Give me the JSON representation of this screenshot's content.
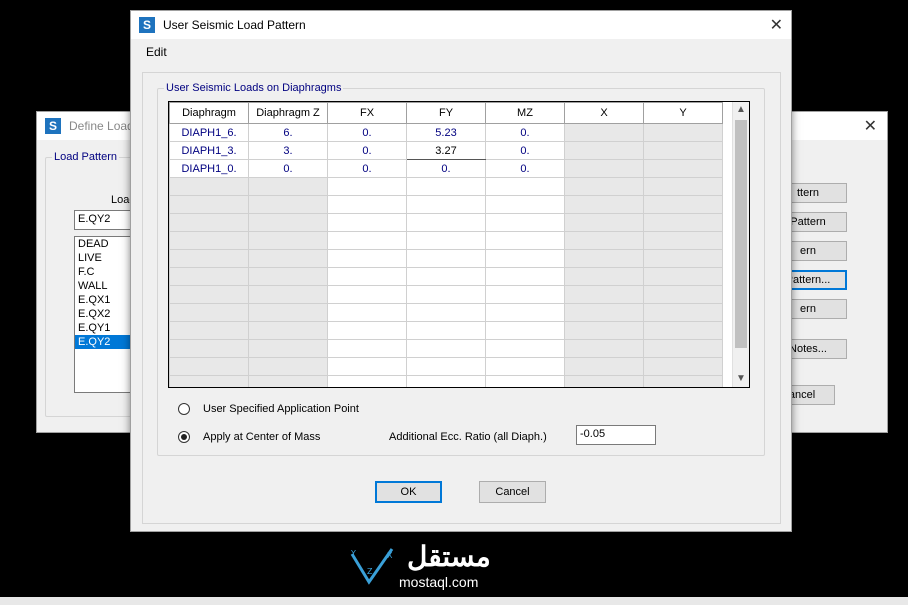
{
  "background_window": {
    "title": "Define Load",
    "group_label": "Load Pattern",
    "load_label": "Load",
    "current_value": "E.QY2",
    "items": [
      "DEAD",
      "LIVE",
      "F.C",
      "WALL",
      "E.QX1",
      "E.QX2",
      "E.QY1",
      "E.QY2"
    ],
    "selected_index": 7,
    "buttons": [
      "ttern",
      "Pattern",
      "ern",
      "Pattern...",
      "ern",
      "Notes...",
      "ancel"
    ]
  },
  "dialog": {
    "title": "User Seismic Load Pattern",
    "app_icon": "S",
    "menu": {
      "edit": "Edit"
    },
    "group_label": "User Seismic Loads on Diaphragms",
    "grid": {
      "columns": [
        "Diaphragm",
        "Diaphragm Z",
        "FX",
        "FY",
        "MZ",
        "X",
        "Y"
      ],
      "rows": [
        [
          "DIAPH1_6.",
          "6.",
          "0.",
          "5.23",
          "0.",
          "",
          ""
        ],
        [
          "DIAPH1_3.",
          "3.",
          "0.",
          "3.27",
          "0.",
          "",
          ""
        ],
        [
          "DIAPH1_0.",
          "0.",
          "0.",
          "0.",
          "0.",
          "",
          ""
        ]
      ]
    },
    "options": {
      "user_point": "User Specified Application Point",
      "center_mass": "Apply at Center of Mass",
      "selected": "center_mass",
      "ecc_label": "Additional Ecc. Ratio (all Diaph.)",
      "ecc_value": "-0.05"
    },
    "ok_label": "OK",
    "cancel_label": "Cancel"
  },
  "watermark": {
    "arabic": "مستقل",
    "latin": "mostaql.com"
  },
  "icons": [
    "app-icon",
    "close-icon",
    "scroll-up-icon",
    "scroll-down-icon",
    "mostaql-logo-icon"
  ]
}
